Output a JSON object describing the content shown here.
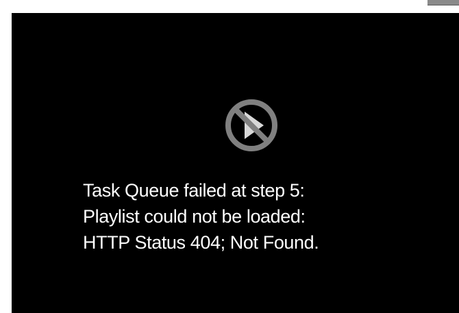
{
  "player": {
    "status_icon": "unavailable-play-icon",
    "error_lines": [
      "Task Queue failed at step 5:",
      "Playlist could not be loaded:",
      "HTTP Status 404; Not Found."
    ]
  },
  "colors": {
    "player_background": "#000000",
    "message_text": "#ffffff",
    "icon_gray": "#808080"
  }
}
